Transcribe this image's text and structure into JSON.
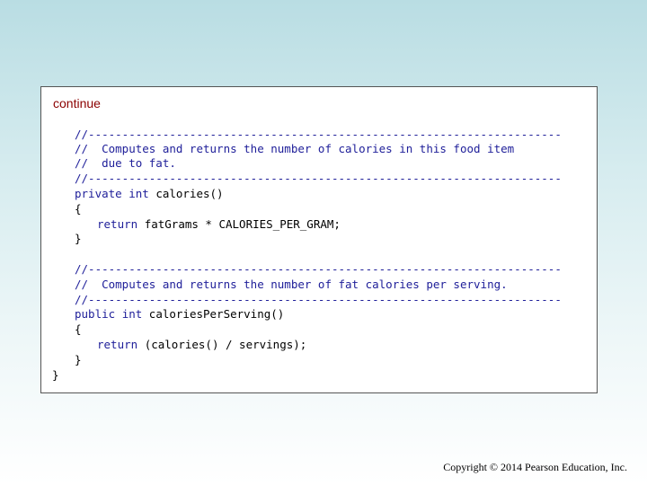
{
  "continue_label": "continue",
  "method1": {
    "comment_rule_top": "//----------------------------------------------------------------------",
    "comment_line1": "//  Computes and returns the number of calories in this food item",
    "comment_line2": "//  due to fat.",
    "comment_rule_bottom": "//----------------------------------------------------------------------",
    "modifier": "private",
    "return_type": "int",
    "signature": "calories()",
    "open_brace": "{",
    "return_kw": "return",
    "return_expr": "fatGrams * CALORIES_PER_GRAM;",
    "close_brace": "}"
  },
  "method2": {
    "comment_rule_top": "//----------------------------------------------------------------------",
    "comment_line1": "//  Computes and returns the number of fat calories per serving.",
    "comment_rule_bottom": "//----------------------------------------------------------------------",
    "modifier": "public",
    "return_type": "int",
    "signature": "caloriesPerServing()",
    "open_brace": "{",
    "return_kw": "return",
    "return_expr": "(calories() / servings);",
    "close_brace": "}"
  },
  "class_close_brace": "}",
  "copyright": "Copyright © 2014 Pearson Education, Inc."
}
